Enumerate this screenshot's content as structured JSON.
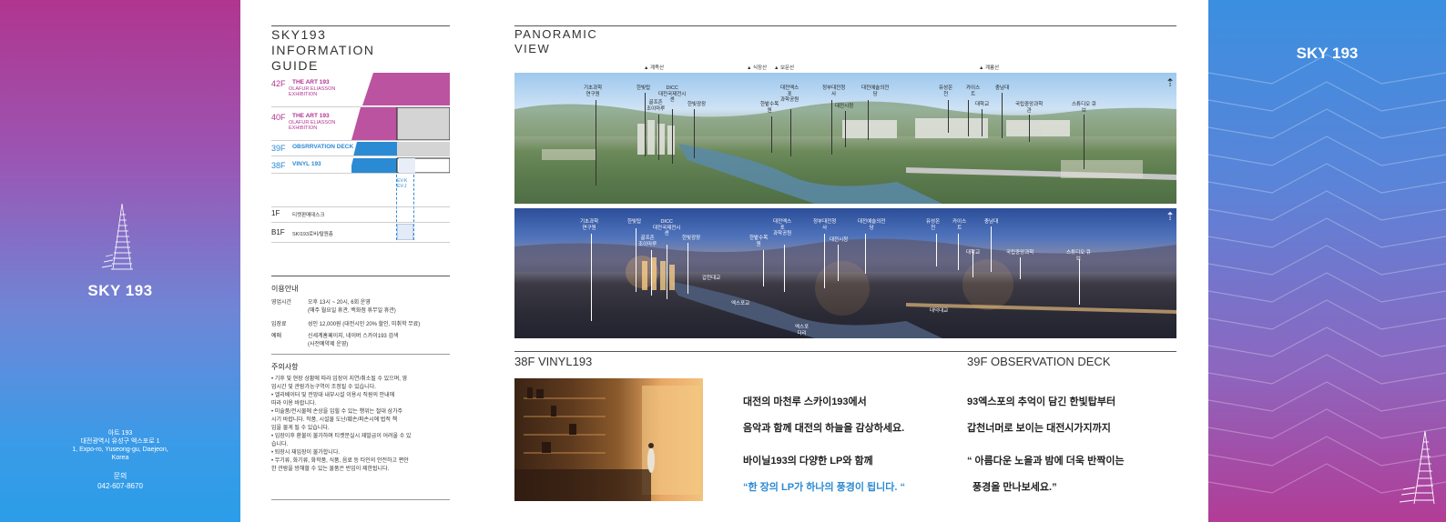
{
  "left_panel": {
    "brand": "SKY 193",
    "address_name": "아트 193",
    "address_kr": "대전광역시 유성구 엑스포로 1",
    "address_en1": "1, Expo-ro, Yuseong-gu, Daejeon,",
    "address_en2": "Korea",
    "inquiry_label": "문의",
    "phone": "042-607-8670"
  },
  "info_guide": {
    "title_line1": "SKY193",
    "title_line2": "INFORMATION",
    "title_line3": "GUIDE",
    "floors": [
      {
        "num": "42F",
        "title": "THE ART 193",
        "sub": "OLAFUR ELIASSON EXHIBITION"
      },
      {
        "num": "40F",
        "title": "THE ART 193",
        "sub": "OLAFUR ELIASSON EXHIBITION"
      },
      {
        "num": "39F",
        "title": "OBSRRVATION DECK",
        "sub": ""
      },
      {
        "num": "38F",
        "title": "VINYL 193",
        "sub": ""
      }
    ],
    "ev_label": "EV-K\nEV-J",
    "floor_1f": {
      "num": "1F",
      "desc": "티켓판매데스크"
    },
    "floor_b1f": {
      "num": "B1F",
      "desc": "SKI193로비/탈원층"
    },
    "usage_title": "이용안내",
    "usage": [
      {
        "key": "영업시간",
        "val1": "오후 13시 ~ 20시, 6회 운영",
        "val2": "(매주 월요일 휴관, 백화점 휴무일 휴관)"
      },
      {
        "key": "입장료",
        "val1": "성인 12,000원 (대전시민 20% 할인, 미취학 무료)",
        "val2": ""
      },
      {
        "key": "예매",
        "val1": "신세계홈페이지, 네이버 스카이193 검색",
        "val2": "(사전예약제 운영)"
      }
    ],
    "caution_title": "주의사항",
    "cautions": [
      "• 기후 및 현장 상황에 따라 입장이 지연/취소될 수 있으며, 영",
      "  업시간 및 관람가능구역이 조정될 수 있습니다.",
      "• 엘리베이터 및 전망대 내부시설 이용시 직원의 안내에",
      "  따라 이용 바랍니다.",
      "• 미술품/전시물에 손상을 입힐 수 있는 행위는 절대 삼가주",
      "  시기 바랍니다. 작품, 시설물 도난/훼손/파손시에 법적 책",
      "  임을 물게 될 수 있습니다.",
      "• 입장이후 환불이 불가하며 티켓분실시 재발급이 어려울 수 있",
      "  습니다.",
      "• 퇴장시 재입장이 불가합니다.",
      "• 무기류, 화기류, 화학품, 식품, 음료 등 타인의 안전하고 편안",
      "  한 관람을 방해할 수 있는 물품은 반입이 제한됩니다."
    ]
  },
  "panorama": {
    "title_line1": "PANORAMIC",
    "title_line2": "VIEW",
    "mountains": [
      "계족산",
      "식장산",
      "보문산",
      "계룡산"
    ],
    "day_labels": [
      "기초과학\n연구원",
      "한빛탑",
      "DICC\n대전국제전시\n센",
      "골프존\n조이마루",
      "한빛광장",
      "한밭수목\n원",
      "대전엑스\n포\n과학공원",
      "정부대전청\n사",
      "대전시청",
      "대전예술의전\n당",
      "유성온\n천",
      "카이스\n트",
      "대학교",
      "충남대",
      "국립중앙과학\n관",
      "스튜디오 큐\n브"
    ],
    "night_labels": [
      "기초과학\n연구원",
      "한빛탑",
      "DICC\n대전국제전시\n센",
      "골프존\n조이마루",
      "한빛광장",
      "한밭수목\n원",
      "대전엑스\n포\n과학공원",
      "정부대전청\n사",
      "대전시청",
      "대전예술의전\n당",
      "유성온\n천",
      "카이스\n트",
      "대학교",
      "충남대",
      "국립중앙과학",
      "스튜디오 큐\n브",
      "갑천대교",
      "엑스포교",
      "엑스포\n다리",
      "대덕대교"
    ]
  },
  "vinyl": {
    "title": "38F VINYL193",
    "lines": [
      "대전의 마천루 스카이193에서",
      "음악과 함께 대전의 하늘을 감상하세요.",
      "바이닐193의 다양한 LP와 함께",
      "“한 장의 LP가 하나의 풍경이 됩니다. “"
    ]
  },
  "observation": {
    "title": "39F OBSERVATION DECK",
    "lines": [
      "93엑스포의 추억이 담긴 한빛탑부터",
      "갑천너머로 보이는 대전시가지까지",
      "“ 아름다운 노을과 밤에 더욱 반짝이는",
      "풍경을 만나보세요.”"
    ]
  },
  "right_panel": {
    "brand": "SKY 193"
  },
  "colors": {
    "pink": "#b0358f",
    "blue": "#2b8ad4",
    "accent_text": "#2b8ad4"
  }
}
